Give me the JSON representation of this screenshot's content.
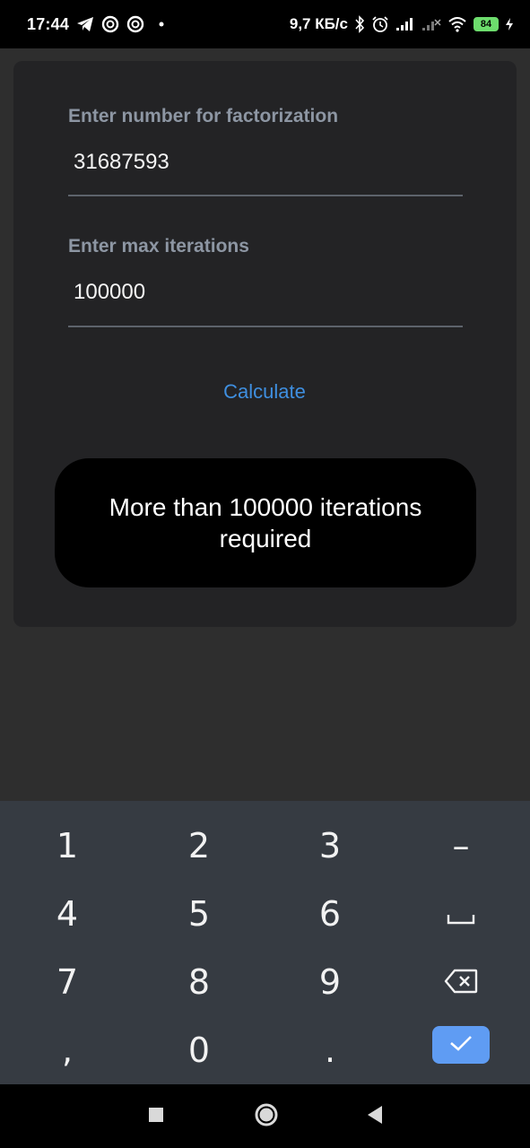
{
  "status_bar": {
    "time": "17:44",
    "speed": "9,7 КБ/с",
    "battery": "84",
    "icons": [
      "telegram-icon",
      "vpn-icon",
      "vpn-icon",
      "dot-icon",
      "bluetooth-icon",
      "alarm-icon",
      "signal-icon",
      "signal-no-data-icon",
      "wifi-icon",
      "battery-icon",
      "charging-icon"
    ]
  },
  "form": {
    "number_label": "Enter number for factorization",
    "number_value": "31687593",
    "iterations_label": "Enter max iterations",
    "iterations_value": "100000",
    "calculate_label": "Calculate"
  },
  "toast": {
    "message": "More than 100000 iterations required"
  },
  "keypad": {
    "keys": [
      "1",
      "2",
      "3",
      "–",
      "4",
      "5",
      "6",
      "space",
      "7",
      "8",
      "9",
      "backspace",
      ",",
      "0",
      ".",
      "done"
    ],
    "accent": "#5f9cf3"
  },
  "colors": {
    "background": "#2e2e2e",
    "dialog": "#232325",
    "accent": "#3f8fe0",
    "keypad": "#363b42"
  }
}
